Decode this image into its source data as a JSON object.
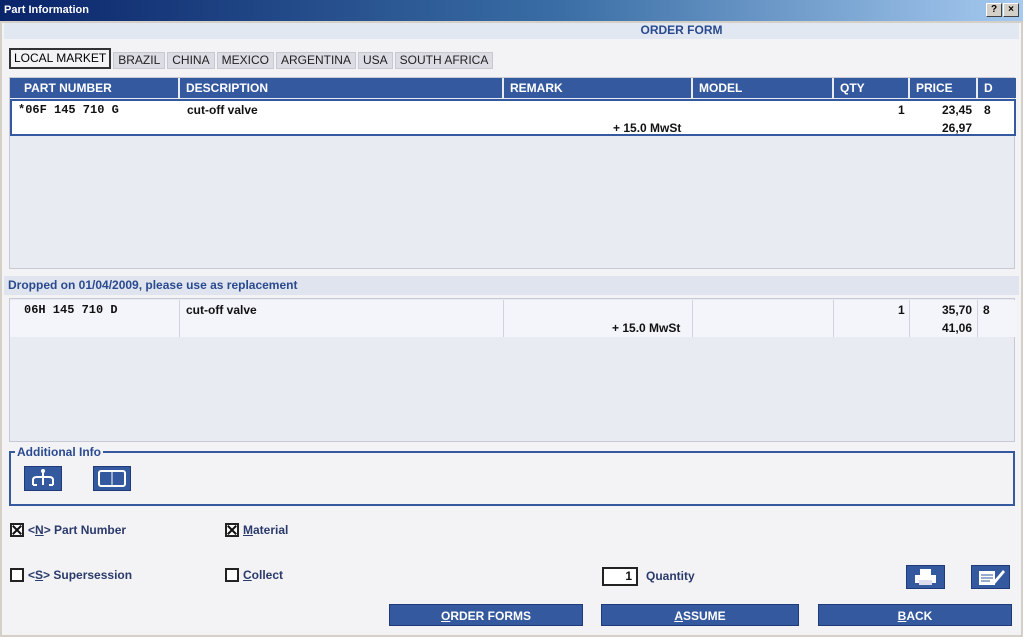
{
  "window": {
    "title": "Part Information",
    "help_btn": "?",
    "close_btn": "×"
  },
  "form_header": "ORDER FORM",
  "tabs": [
    {
      "label": "LOCAL MARKET",
      "active": true
    },
    {
      "label": "BRAZIL"
    },
    {
      "label": "CHINA"
    },
    {
      "label": "MEXICO"
    },
    {
      "label": "ARGENTINA"
    },
    {
      "label": "USA"
    },
    {
      "label": "SOUTH AFRICA"
    }
  ],
  "columns": [
    "PART NUMBER",
    "DESCRIPTION",
    "REMARK",
    "MODEL",
    "QTY",
    "PRICE",
    "D"
  ],
  "current_part": {
    "part_number": "*06F 145 710 G",
    "description": "cut-off valve",
    "remark": "",
    "model": "",
    "qty": "1",
    "price": "23,45",
    "d": "8",
    "tax_note": "+ 15.0 MwSt",
    "price_with_tax": "26,97"
  },
  "dropped_message": "Dropped on 01/04/2009, please use as replacement",
  "replacement_part": {
    "part_number": "06H 145 710 D",
    "description": "cut-off valve",
    "qty": "1",
    "price": "35,70",
    "d": "8",
    "tax_note": "+ 15.0 MwSt",
    "price_with_tax": "41,06"
  },
  "additional_info": {
    "label": "Additional Info",
    "icons": [
      "hierarchy-icon",
      "book-icon"
    ]
  },
  "options": {
    "part_number": {
      "prefix": "<",
      "key": "N",
      "suffix": "> Part Number",
      "checked": true
    },
    "material": {
      "key": "M",
      "rest": "aterial",
      "checked": true
    },
    "supersession": {
      "prefix": "<",
      "key": "S",
      "suffix": "> Supersession",
      "checked": false
    },
    "collect": {
      "key": "C",
      "rest": "ollect",
      "checked": false
    }
  },
  "quantity": {
    "value": "1",
    "label": "Quantity"
  },
  "buttons": {
    "order_forms": {
      "key": "O",
      "rest": "RDER FORMS"
    },
    "assume": {
      "key": "A",
      "rest": "SSUME"
    },
    "back": {
      "key": "B",
      "rest": "ACK"
    }
  },
  "colors": {
    "accent": "#34599e",
    "title_bar": "#0a246a",
    "header_text": "#2a4a90"
  }
}
